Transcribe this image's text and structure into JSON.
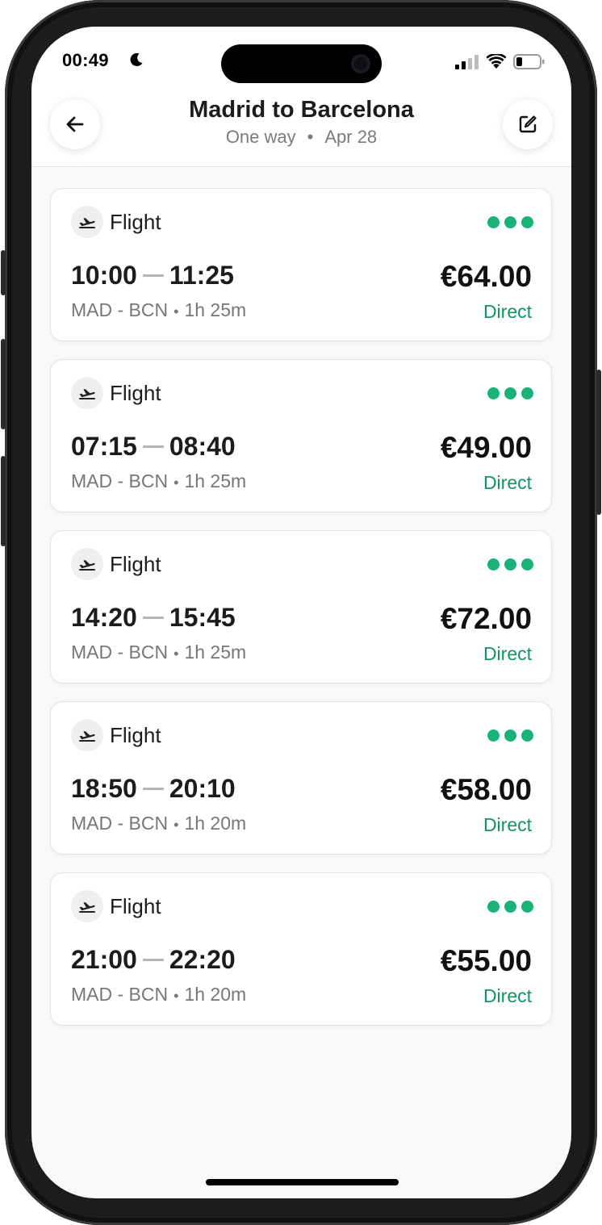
{
  "status_bar": {
    "time": "00:49"
  },
  "header": {
    "title": "Madrid to Barcelona",
    "trip_type": "One way",
    "separator": "•",
    "date": "Apr 28"
  },
  "results": [
    {
      "type": "Flight",
      "depart": "10:00",
      "arrive": "11:25",
      "route": "MAD - BCN",
      "duration": "1h 25m",
      "price": "€64.00",
      "stops": "Direct"
    },
    {
      "type": "Flight",
      "depart": "07:15",
      "arrive": "08:40",
      "route": "MAD - BCN",
      "duration": "1h 25m",
      "price": "€49.00",
      "stops": "Direct"
    },
    {
      "type": "Flight",
      "depart": "14:20",
      "arrive": "15:45",
      "route": "MAD - BCN",
      "duration": "1h 25m",
      "price": "€72.00",
      "stops": "Direct"
    },
    {
      "type": "Flight",
      "depart": "18:50",
      "arrive": "20:10",
      "route": "MAD - BCN",
      "duration": "1h 20m",
      "price": "€58.00",
      "stops": "Direct"
    },
    {
      "type": "Flight",
      "depart": "21:00",
      "arrive": "22:20",
      "route": "MAD - BCN",
      "duration": "1h 20m",
      "price": "€55.00",
      "stops": "Direct"
    }
  ],
  "route_separator": "•",
  "icons": {
    "back": "arrow-left-icon",
    "edit": "edit-icon",
    "flight": "plane-takeoff-icon",
    "more": "more-dots-icon"
  },
  "colors": {
    "accent_green": "#19b378",
    "direct_text": "#12935f",
    "background": "#f9f9f9"
  }
}
